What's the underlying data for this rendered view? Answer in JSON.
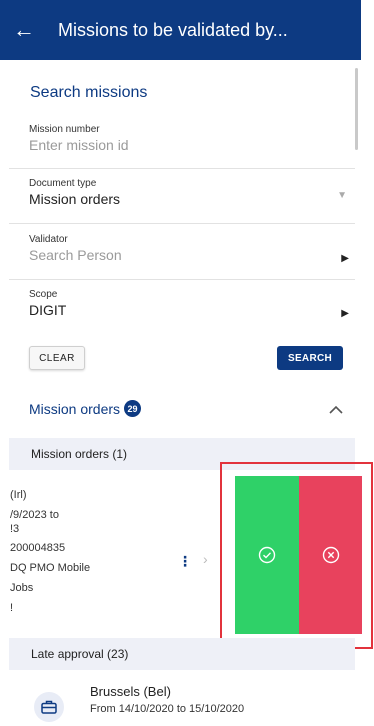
{
  "appbar": {
    "back_glyph": "←",
    "title": "Missions to be validated by..."
  },
  "search": {
    "title": "Search missions",
    "mission_number": {
      "label": "Mission number",
      "placeholder": "Enter mission id"
    },
    "document_type": {
      "label": "Document type",
      "value": "Mission orders"
    },
    "validator": {
      "label": "Validator",
      "placeholder": "Search Person"
    },
    "scope": {
      "label": "Scope",
      "value": "DIGIT"
    },
    "clear_label": "CLEAR",
    "search_label": "SEARCH"
  },
  "results": {
    "title": "Mission orders",
    "count": "29",
    "group_mission_orders": "Mission orders (1)",
    "card_lines": [
      "(Irl)",
      "/9/2023 to",
      "!3",
      "200004835",
      "DQ PMO Mobile",
      "Jobs",
      "!"
    ],
    "group_late_approval": "Late approval (23)",
    "late_item": {
      "title": "Brussels (Bel)",
      "subtitle": "From 14/10/2020 to 15/10/2020"
    }
  },
  "colors": {
    "brand": "#0d3a82",
    "accept": "#2fd168",
    "reject": "#e8425d",
    "highlight": "#e2323c"
  },
  "icons": [
    "back-arrow-icon",
    "dropdown-caret-icon",
    "arrow-right-icon",
    "chevron-up-icon",
    "kebab-menu-icon",
    "chevron-right-icon",
    "check-circle-icon",
    "x-circle-icon",
    "briefcase-icon"
  ]
}
